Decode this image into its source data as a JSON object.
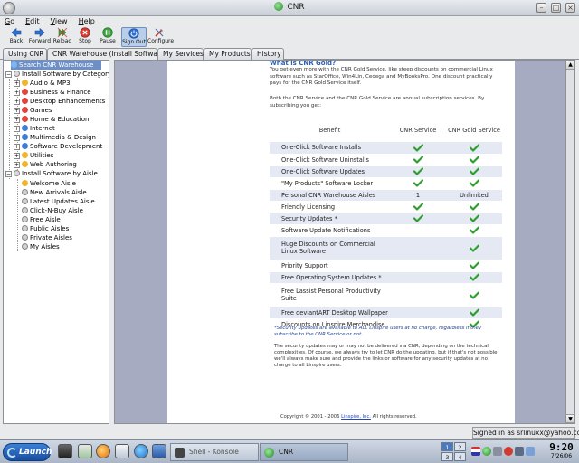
{
  "window": {
    "title": "CNR"
  },
  "menu": [
    "Go",
    "Edit",
    "View",
    "Help"
  ],
  "toolbar": {
    "buttons": [
      {
        "label": "Back",
        "icon": "arrow-left-icon"
      },
      {
        "label": "Forward",
        "icon": "arrow-right-icon"
      },
      {
        "label": "Reload",
        "icon": "reload-icon"
      },
      {
        "label": "Stop",
        "icon": "stop-icon"
      },
      {
        "label": "Pause",
        "icon": "pause-icon"
      },
      {
        "label": "Sign Out",
        "icon": "sign-out-icon"
      },
      {
        "label": "Configure",
        "icon": "configure-icon"
      }
    ]
  },
  "tabs": [
    "Using CNR",
    "CNR Warehouse (Install Software)",
    "My Services",
    "My Products",
    "History"
  ],
  "selected_tab": "CNR Warehouse (Install Software)",
  "tree": {
    "search": "Search CNR Warehouse",
    "by_category": "Install Software by Category",
    "categories": [
      "Audio & MP3",
      "Business & Finance",
      "Desktop Enhancements",
      "Games",
      "Home & Education",
      "Internet",
      "Multimedia & Design",
      "Software Development",
      "Utilities",
      "Web Authoring"
    ],
    "by_aisle": "Install Software by Aisle",
    "aisles": [
      "Welcome Aisle",
      "New Arrivals Aisle",
      "Latest Updates Aisle",
      "Click-N-Buy Aisle",
      "Free Aisle",
      "Public Aisles",
      "Private Aisles",
      "My Aisles"
    ]
  },
  "content": {
    "heading": "What is CNR Gold?",
    "para1": "You get even more with the CNR Gold Service, like steep discounts on commercial Linux software such as StarOffice, Win4Lin, Cedega and MyBooksPro. One discount practically pays for the CNR Gold Service itself.",
    "para2": "Both the CNR Service and the CNR Gold Service are annual subscription services. By subscribing you get:",
    "table": {
      "headers": [
        "Benefit",
        "CNR Service",
        "CNR Gold Service"
      ],
      "rows": [
        {
          "benefit": "One-Click Software Installs",
          "cnr": "check",
          "gold": "check"
        },
        {
          "benefit": "One-Click Software Uninstalls",
          "cnr": "check",
          "gold": "check"
        },
        {
          "benefit": "One-Click Software Updates",
          "cnr": "check",
          "gold": "check"
        },
        {
          "benefit": "\"My Products\" Software Locker",
          "cnr": "check",
          "gold": "check"
        },
        {
          "benefit": "Personal CNR Warehouse Aisles",
          "cnr": "1",
          "gold": "Unlimited"
        },
        {
          "benefit": "Friendly Licensing",
          "cnr": "check",
          "gold": "check"
        },
        {
          "benefit": "Security Updates *",
          "cnr": "check",
          "gold": "check"
        },
        {
          "benefit": "Software Update Notifications",
          "cnr": "",
          "gold": "check"
        },
        {
          "benefit": "Huge Discounts on Commercial Linux Software",
          "cnr": "",
          "gold": "check"
        },
        {
          "benefit": "Priority Support",
          "cnr": "",
          "gold": "check"
        },
        {
          "benefit": "Free Operating System Updates *",
          "cnr": "",
          "gold": "check"
        },
        {
          "benefit": "Free Lassist Personal Productivity Suite",
          "cnr": "",
          "gold": "check"
        },
        {
          "benefit": "Free deviantART Desktop Wallpaper",
          "cnr": "",
          "gold": "check"
        },
        {
          "benefit": "Discounts on Linspire Merchandise",
          "cnr": "",
          "gold": "check"
        }
      ]
    },
    "note1": "*Security updates are available to ALL Linspire users at no charge, regardless if they subscribe to the CNR Service or not.",
    "note2": "The security updates may or may not be delivered via CNR, depending on the technical complexities. Of course, we always try to let CNR do the updating, but if that's not possible, we'll always make sure and provide the links or software for any security updates at no charge to all Linspire users.",
    "footer_pre": "Copyright © 2001 - 2006 ",
    "footer_link": "Linspire, Inc.",
    "footer_post": " All rights reserved."
  },
  "status": {
    "signed_in": "Signed in as srlinuxx@yahoo.com"
  },
  "taskbar": {
    "launch": "Launch",
    "tasks": [
      "Shell - Konsole",
      "CNR"
    ],
    "pager": [
      "1",
      "2",
      "3",
      "4"
    ],
    "clock_time": "9:20",
    "clock_date": "7/26/06"
  },
  "colors": {
    "selected_blue": "#6d8fc7",
    "row_alt": "#e4e9f4",
    "check_green": "#2e9e2e",
    "heading_blue": "#2e5fa8"
  }
}
